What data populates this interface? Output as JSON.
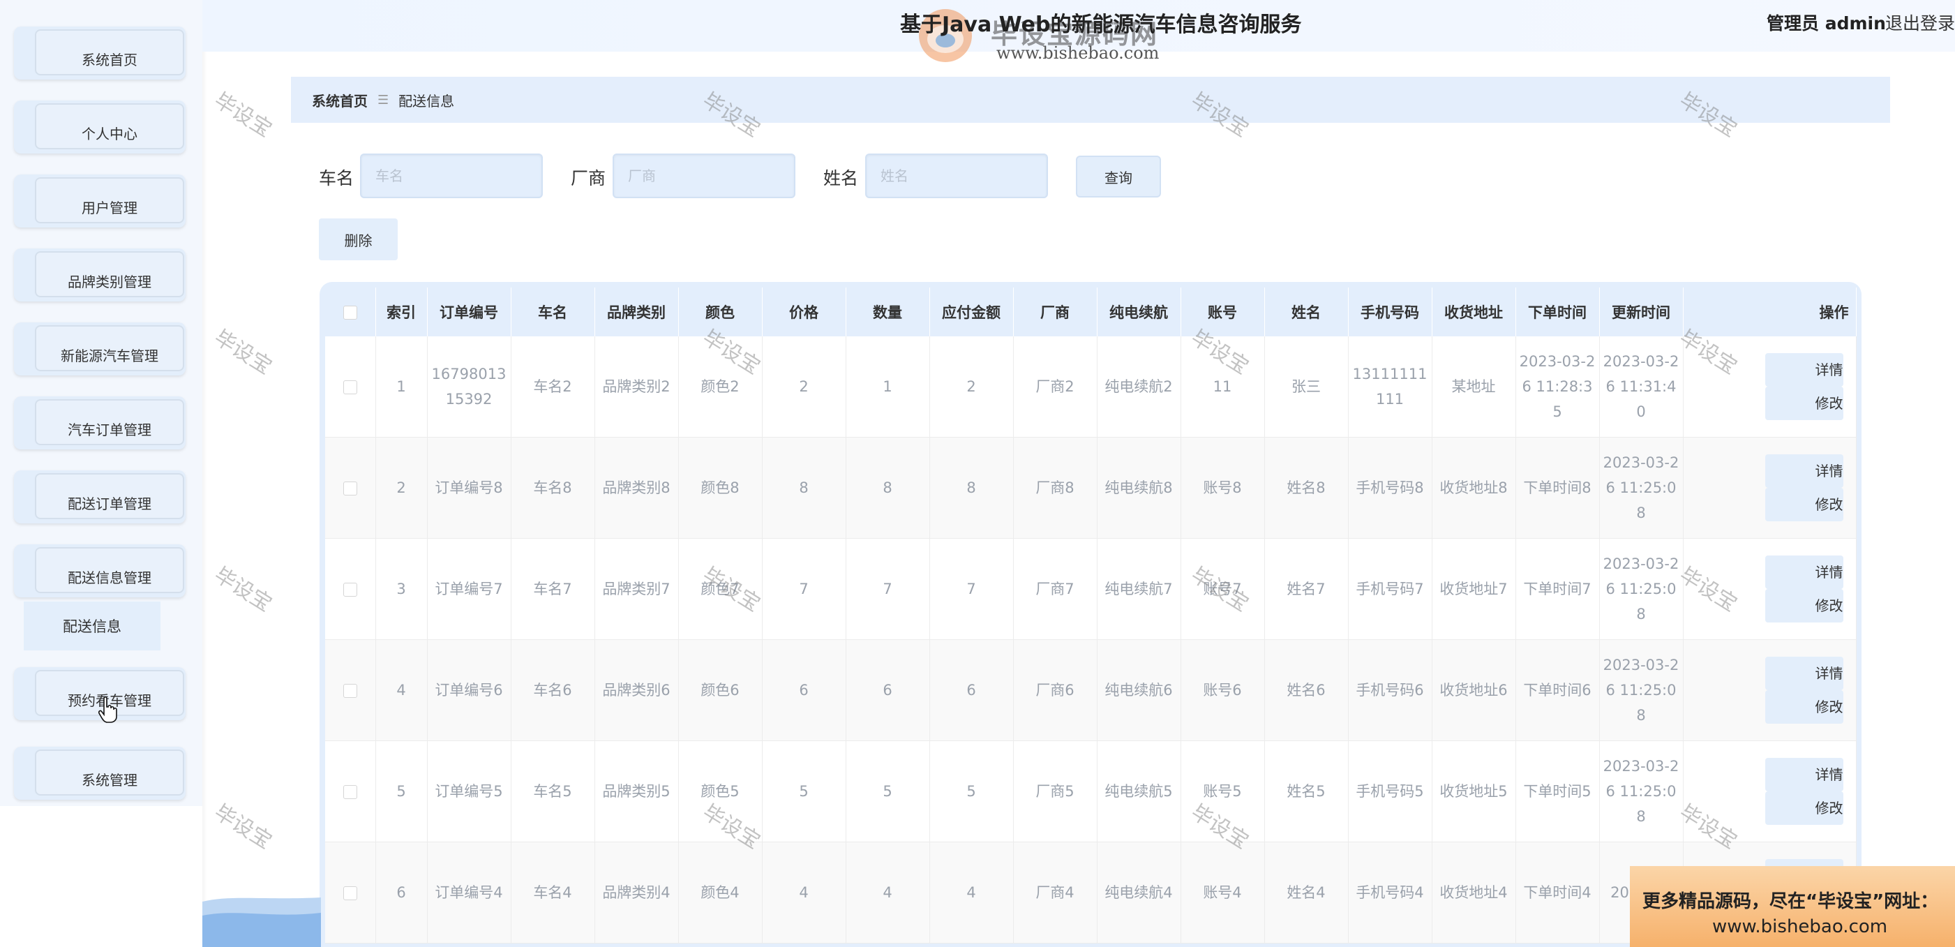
{
  "header": {
    "title": "基于Java Web的新能源汽车信息咨询服务",
    "admin_label": "管理员 admin",
    "logout_label": "退出登录",
    "logo_name": "毕设宝源码网",
    "logo_url": "www.bishebao.com"
  },
  "sidebar": {
    "items": [
      {
        "label": "系统首页"
      },
      {
        "label": "个人中心"
      },
      {
        "label": "用户管理"
      },
      {
        "label": "品牌类别管理"
      },
      {
        "label": "新能源汽车管理"
      },
      {
        "label": "汽车订单管理"
      },
      {
        "label": "配送订单管理"
      },
      {
        "label": "配送信息管理"
      },
      {
        "label": "预约看车管理"
      },
      {
        "label": "系统管理"
      }
    ],
    "submenu_active": "配送信息"
  },
  "breadcrumb": {
    "home": "系统首页",
    "sep": "☰",
    "current": "配送信息"
  },
  "search": {
    "car_label": "车名",
    "car_placeholder": "车名",
    "maker_label": "厂商",
    "maker_placeholder": "厂商",
    "name_label": "姓名",
    "name_placeholder": "姓名",
    "query_label": "查询"
  },
  "toolbar": {
    "delete_label": "删除"
  },
  "table": {
    "headers": [
      "索引",
      "订单编号",
      "车名",
      "品牌类别",
      "颜色",
      "价格",
      "数量",
      "应付金额",
      "厂商",
      "纯电续航",
      "账号",
      "姓名",
      "手机号码",
      "收货地址",
      "下单时间",
      "更新时间",
      "操作"
    ],
    "detail_label": "详情",
    "edit_label": "修改",
    "rows": [
      [
        "1",
        "1679801315392",
        "车名2",
        "品牌类别2",
        "颜色2",
        "2",
        "1",
        "2",
        "厂商2",
        "纯电续航2",
        "11",
        "张三",
        "13111111111",
        "某地址",
        "2023-03-26 11:28:35",
        "2023-03-26 11:31:40"
      ],
      [
        "2",
        "订单编号8",
        "车名8",
        "品牌类别8",
        "颜色8",
        "8",
        "8",
        "8",
        "厂商8",
        "纯电续航8",
        "账号8",
        "姓名8",
        "手机号码8",
        "收货地址8",
        "下单时间8",
        "2023-03-26 11:25:08"
      ],
      [
        "3",
        "订单编号7",
        "车名7",
        "品牌类别7",
        "颜色7",
        "7",
        "7",
        "7",
        "厂商7",
        "纯电续航7",
        "账号7",
        "姓名7",
        "手机号码7",
        "收货地址7",
        "下单时间7",
        "2023-03-26 11:25:08"
      ],
      [
        "4",
        "订单编号6",
        "车名6",
        "品牌类别6",
        "颜色6",
        "6",
        "6",
        "6",
        "厂商6",
        "纯电续航6",
        "账号6",
        "姓名6",
        "手机号码6",
        "收货地址6",
        "下单时间6",
        "2023-03-26 11:25:08"
      ],
      [
        "5",
        "订单编号5",
        "车名5",
        "品牌类别5",
        "颜色5",
        "5",
        "5",
        "5",
        "厂商5",
        "纯电续航5",
        "账号5",
        "姓名5",
        "手机号码5",
        "收货地址5",
        "下单时间5",
        "2023-03-26 11:25:08"
      ],
      [
        "6",
        "订单编号4",
        "车名4",
        "品牌类别4",
        "颜色4",
        "4",
        "4",
        "4",
        "厂商4",
        "纯电续航4",
        "账号4",
        "姓名4",
        "手机号码4",
        "收货地址4",
        "下单时间4",
        "2023-03"
      ]
    ]
  },
  "watermark_text": "毕设宝",
  "ad": {
    "line1": "更多精品源码，尽在“毕设宝”网址：",
    "line2": "www.bishebao.com"
  },
  "colors": {
    "accent_light": "#e3eefb",
    "ad_orange": "#f6b16b"
  }
}
